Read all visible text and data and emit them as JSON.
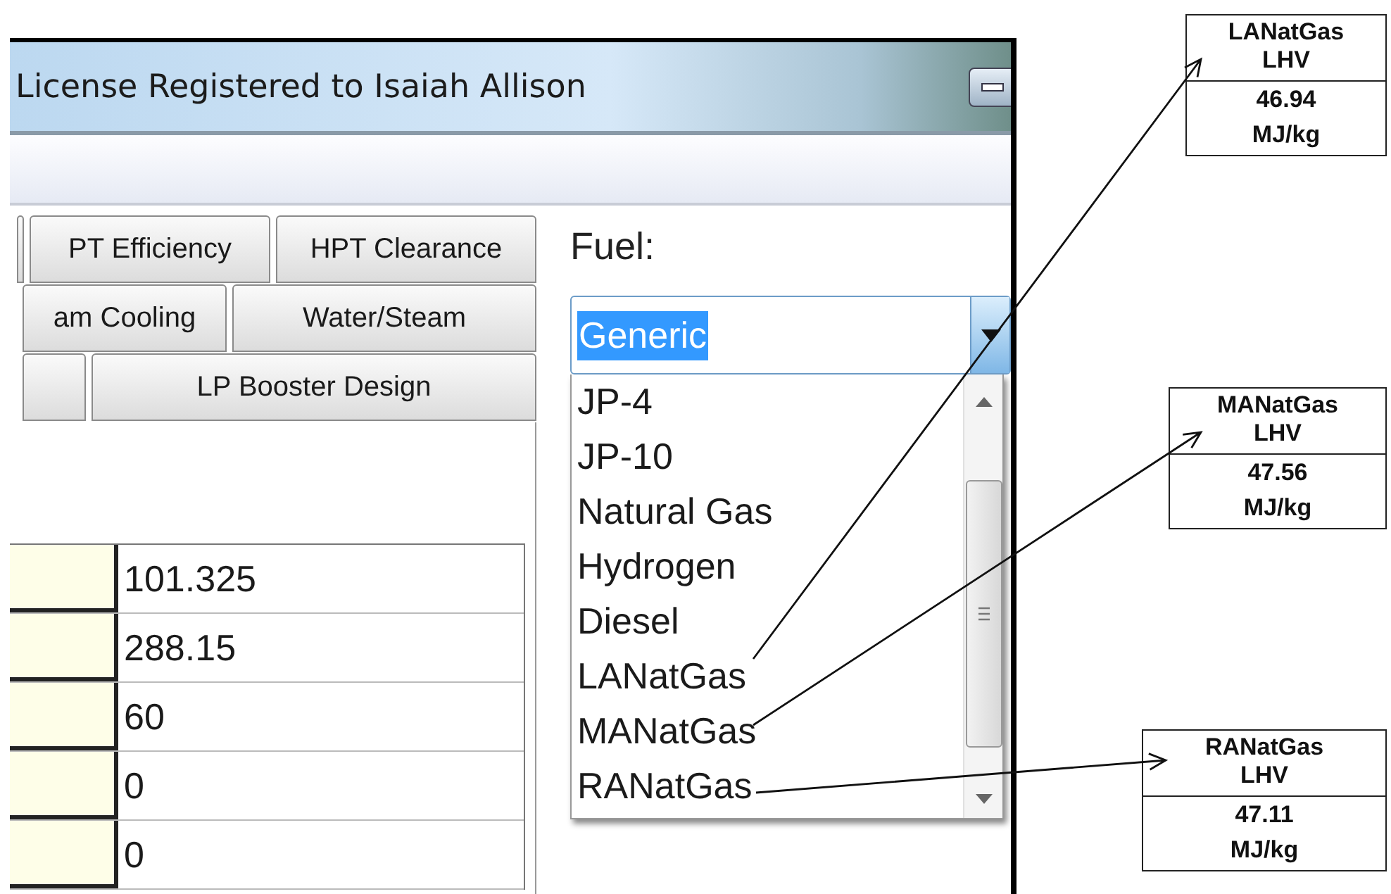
{
  "window": {
    "title": "License Registered to Isaiah Allison"
  },
  "tab_rows": [
    [
      {
        "kind": "blank"
      },
      {
        "kind": "label",
        "label": "PT Efficiency"
      },
      {
        "kind": "label",
        "label": "HPT Clearance"
      }
    ],
    [
      {
        "kind": "label",
        "label": "am Cooling"
      },
      {
        "kind": "label",
        "label": "Water/Steam"
      }
    ],
    [
      {
        "kind": "blank"
      },
      {
        "kind": "label",
        "label": "LP Booster Design"
      }
    ]
  ],
  "table": {
    "rows": [
      {
        "value": "101.325"
      },
      {
        "value": "288.15"
      },
      {
        "value": "60"
      },
      {
        "value": "0"
      },
      {
        "value": "0"
      }
    ]
  },
  "fuel": {
    "label": "Fuel:",
    "value": "Generic",
    "options": [
      "JP-4",
      "JP-10",
      "Natural Gas",
      "Hydrogen",
      "Diesel",
      "LANatGas",
      "MANatGas",
      "RANatGas"
    ]
  },
  "callouts": [
    {
      "name": "LANatGas",
      "quantity": "LHV",
      "value": "46.94",
      "unit": "MJ/kg"
    },
    {
      "name": "MANatGas",
      "quantity": "LHV",
      "value": "47.56",
      "unit": "MJ/kg"
    },
    {
      "name": "RANatGas",
      "quantity": "LHV",
      "value": "47.11",
      "unit": "MJ/kg"
    }
  ]
}
